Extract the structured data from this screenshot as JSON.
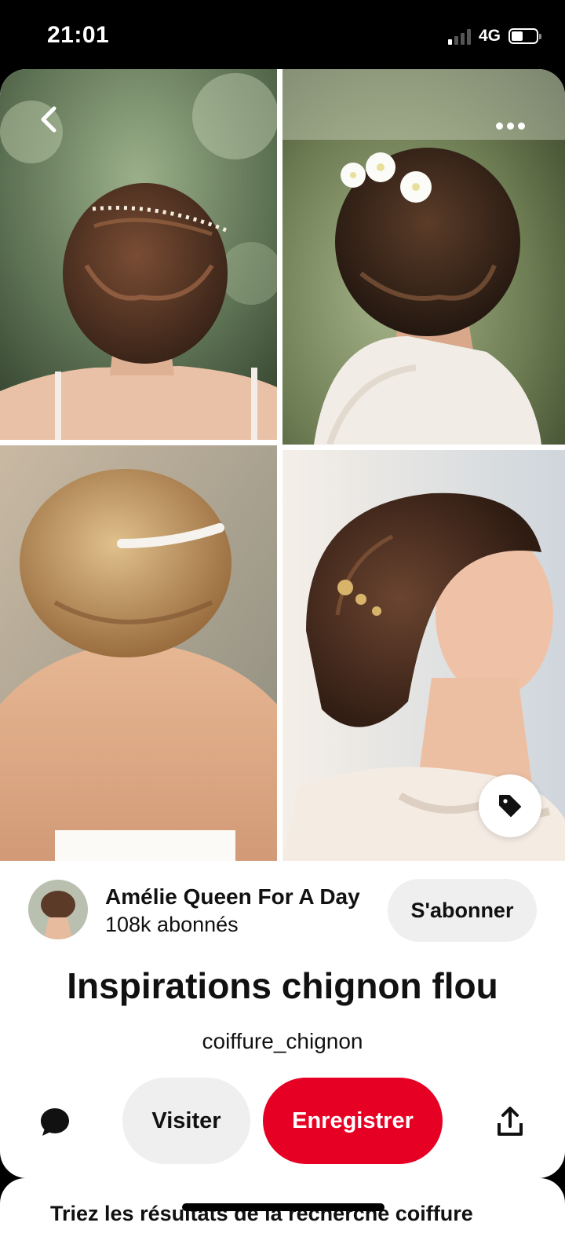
{
  "status_bar": {
    "time": "21:01",
    "network": "4G"
  },
  "pin": {
    "images": [
      "hair-vine-bun",
      "flower-updo",
      "pearl-comb-chignon",
      "gold-pin-side-bun"
    ],
    "creator": {
      "name": "Amélie Queen For A Day",
      "followers": "108k abonnés",
      "follow_label": "S'abonner"
    },
    "title": "Inspirations chignon flou",
    "source": "coiffure_chignon"
  },
  "actions": {
    "visit_label": "Visiter",
    "save_label": "Enregistrer"
  },
  "next_section": {
    "text": "Triez les résultats de la recherche coiffure"
  },
  "colors": {
    "save_red": "#e60023",
    "button_gray": "#efefef"
  }
}
